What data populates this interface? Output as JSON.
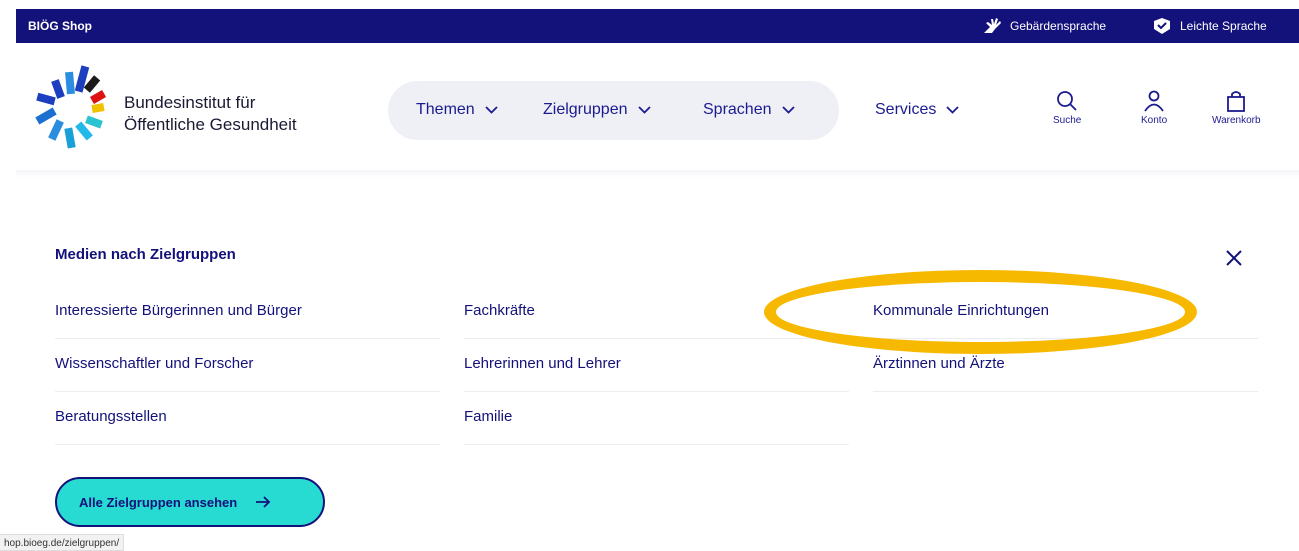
{
  "topbar": {
    "shop_label": "BIÖG Shop",
    "sign_language": "Gebärdensprache",
    "easy_language": "Leichte Sprache"
  },
  "header": {
    "brand_line1": "Bundesinstitut für",
    "brand_line2": "Öffentliche Gesundheit",
    "nav": [
      "Themen",
      "Zielgruppen",
      "Sprachen",
      "Services"
    ],
    "tools": {
      "search": "Suche",
      "account": "Konto",
      "cart": "Warenkorb"
    }
  },
  "menu": {
    "title": "Medien nach Zielgruppen",
    "columns": [
      [
        "Interessierte Bürgerinnen und Bürger",
        "Wissenschaftler und Forscher",
        "Beratungsstellen"
      ],
      [
        "Fachkräfte",
        "Lehrerinnen und Lehrer",
        "Familie"
      ],
      [
        "Kommunale Einrichtungen",
        "Ärztinnen und Ärzte"
      ]
    ],
    "cta": "Alle Zielgruppen ansehen"
  },
  "status_url": "hop.bioeg.de/zielgruppen/",
  "colors": {
    "navy": "#13117a",
    "cta": "#27dbd2",
    "highlight": "#f7b800"
  }
}
